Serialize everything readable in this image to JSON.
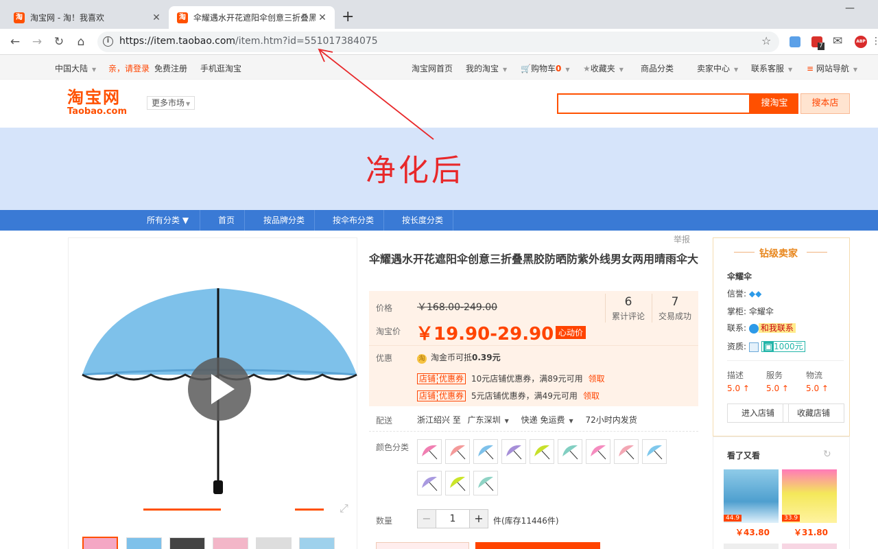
{
  "browser": {
    "tabs": [
      {
        "title": "淘宝网 - 淘！我喜欢",
        "favicon": "淘"
      },
      {
        "title": "伞耀遇水开花遮阳伞创意三折叠黑胶防晒防紫外线男女两用晴雨伞大",
        "favicon": "淘"
      }
    ],
    "new_tab": "+",
    "url_host": "https://item.taobao.com",
    "url_path": "/item.htm?id=551017384075",
    "ext_badge": "7",
    "abp_label": "ABP"
  },
  "site_nav": {
    "region": "中国大陆",
    "login": "亲，请登录",
    "register": "免费注册",
    "mobile": "手机逛淘宝",
    "home": "淘宝网首页",
    "my_taobao": "我的淘宝",
    "cart": "购物车",
    "cart_count": "0",
    "favorites": "收藏夹",
    "categories": "商品分类",
    "seller_center": "卖家中心",
    "service": "联系客服",
    "site_nav": "网站导航"
  },
  "header": {
    "logo_cn": "淘宝网",
    "logo_en": "Taobao.com",
    "more_markets": "更多市场",
    "search_btn": "搜淘宝",
    "shop_btn": "搜本店"
  },
  "annotation": "净化后",
  "category_bar": [
    "所有分类 ▼",
    "首页",
    "按品牌分类",
    "按伞布分类",
    "按长度分类"
  ],
  "product": {
    "report": "举报",
    "title": "伞耀遇水开花遮阳伞创意三折叠黑胶防晒防紫外线男女两用晴雨伞大",
    "price_label": "价格",
    "price_old": "￥168.00-249.00",
    "taobao_price_label": "淘宝价",
    "price_new": "￥19.90-29.90",
    "price_tag": "心动价",
    "reviews_count": "6",
    "reviews_label": "累计评论",
    "trades_count": "7",
    "trades_label": "交易成功",
    "promo_label": "优惠",
    "coin_text": "淘金币可抵",
    "coin_value": "0.39元",
    "coupons": [
      {
        "tag": "店铺",
        "tag2": "优惠券",
        "text": "10元店铺优惠券，满89元可用",
        "link": "领取"
      },
      {
        "tag": "店铺",
        "tag2": "优惠券",
        "text": "5元店铺优惠券，满49元可用",
        "link": "领取"
      }
    ],
    "delivery_label": "配送",
    "delivery_from": "浙江绍兴 至",
    "delivery_to": "广东深圳",
    "delivery_mode": "快递 免运费",
    "delivery_time": "72小时内发货",
    "color_label": "颜色分类",
    "qty_label": "数量",
    "qty_minus": "−",
    "qty_value": "1",
    "qty_plus": "+",
    "stock": "件(库存11446件)"
  },
  "seller": {
    "level": "钻级卖家",
    "shop_name": "伞耀伞",
    "credit_label": "信誉:",
    "manager_label": "掌柜:",
    "manager": "伞耀伞",
    "contact_label": "联系:",
    "contact_btn": "和我联系",
    "qual_label": "资质:",
    "deposit": "1000元",
    "scores": [
      {
        "name": "描述",
        "value": "5.0"
      },
      {
        "name": "服务",
        "value": "5.0"
      },
      {
        "name": "物流",
        "value": "5.0"
      }
    ],
    "enter_shop": "进入店铺",
    "fav_shop": "收藏店铺"
  },
  "related": {
    "title": "看了又看",
    "items": [
      {
        "price": "￥43.80",
        "badge": "44.9"
      },
      {
        "price": "￥31.80",
        "badge": "33.9"
      }
    ]
  },
  "colors": {
    "brand": "#ff5000",
    "price": "#ff4400",
    "nav_blue": "#3a7ad5"
  }
}
